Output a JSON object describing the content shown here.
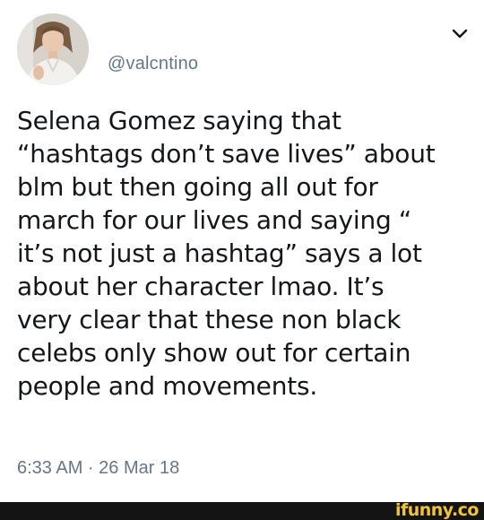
{
  "tweet": {
    "handle": "@valcntino",
    "text_lines": [
      "Selena Gomez saying that",
      "“hashtags don’t save lives” about",
      "blm but then going all out for",
      "march for our lives and saying “",
      "it’s not just a hashtag” says a lot",
      "about her character lmao. It’s",
      "very clear that these non black",
      "celebs only show out for certain",
      "people and movements."
    ],
    "timestamp": "6:33 AM · 26 Mar 18"
  },
  "icons": {
    "menu": "chevron-down-icon",
    "avatar": "profile-photo"
  },
  "watermark": {
    "text": "ifunny.co"
  },
  "colors": {
    "text": "#14171a",
    "secondary": "#657786",
    "footer": "#141414",
    "watermark": "#f2c335"
  }
}
